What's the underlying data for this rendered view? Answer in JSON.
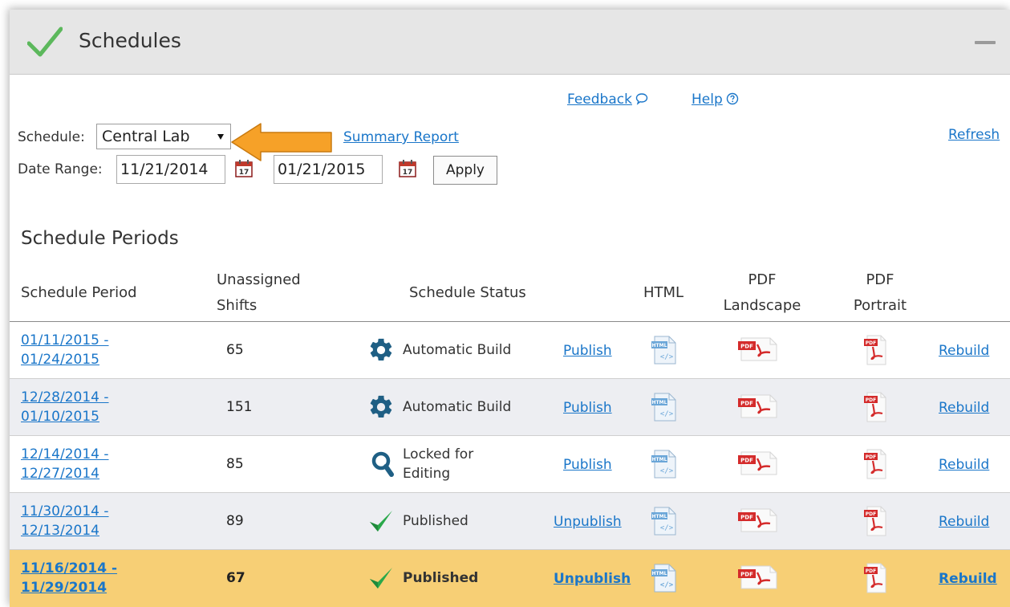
{
  "header": {
    "title": "Schedules",
    "icon": "checkmark-icon"
  },
  "links": {
    "feedback": "Feedback",
    "help": "Help",
    "refresh": "Refresh",
    "report": "Summary Report"
  },
  "form": {
    "schedule_label": "Schedule:",
    "schedule_value": "Central Lab",
    "date_range_label": "Date Range:",
    "start_date": "11/21/2014",
    "end_date": "01/21/2015",
    "apply_label": "Apply"
  },
  "section_title": "Schedule Periods",
  "table": {
    "columns": {
      "period": "Schedule Period",
      "unassigned_1": "Unassigned",
      "unassigned_2": "Shifts",
      "status": "Schedule Status",
      "html": "HTML",
      "pdf_landscape_1": "PDF",
      "pdf_landscape_2": "Landscape",
      "pdf_portrait_1": "PDF",
      "pdf_portrait_2": "Portrait"
    },
    "rows": [
      {
        "start": "01/11/2015 -",
        "end": "01/24/2015",
        "shifts": "65",
        "status_icon": "gear-icon",
        "status_1": "Automatic Build",
        "status_2": "",
        "action": "Publish",
        "rebuild": "Rebuild"
      },
      {
        "start": "12/28/2014 -",
        "end": "01/10/2015",
        "shifts": "151",
        "status_icon": "gear-icon",
        "status_1": "Automatic Build",
        "status_2": "",
        "action": "Publish",
        "rebuild": "Rebuild"
      },
      {
        "start": "12/14/2014 -",
        "end": "12/27/2014",
        "shifts": "85",
        "status_icon": "magnifier-icon",
        "status_1": "Locked for",
        "status_2": "Editing",
        "action": "Publish",
        "rebuild": "Rebuild"
      },
      {
        "start": "11/30/2014 -",
        "end": "12/13/2014",
        "shifts": "89",
        "status_icon": "check-icon",
        "status_1": "Published",
        "status_2": "",
        "action": "Unpublish",
        "rebuild": "Rebuild"
      },
      {
        "start": "11/16/2014 -",
        "end": "11/29/2014",
        "shifts": "67",
        "status_icon": "check-icon",
        "status_1": "Published",
        "status_2": "",
        "action": "Unpublish",
        "rebuild": "Rebuild"
      }
    ]
  },
  "colors": {
    "header_bg": "#e6e6e6",
    "link": "#1a76c9",
    "highlight_row": "#f7cf75",
    "alt_row": "#edeef2",
    "check_green": "#2aa84a",
    "gear_blue": "#1f5f84",
    "arrow_orange": "#f6a128"
  }
}
